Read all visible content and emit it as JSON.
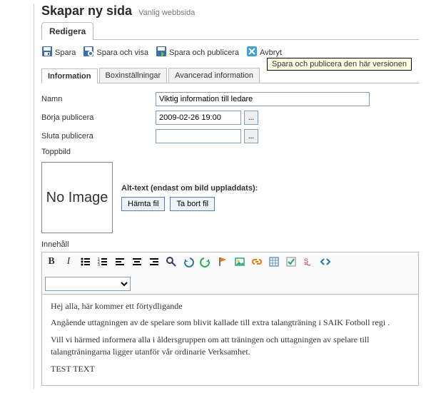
{
  "page": {
    "title": "Skapar ny sida",
    "subtitle": "Vanlig webbsida"
  },
  "mainTab": {
    "label": "Redigera"
  },
  "toolbar": {
    "save": "Spara",
    "saveShow": "Spara och visa",
    "savePublish": "Spara och publicera",
    "cancel": "Avbryt"
  },
  "tooltip": "Spara och publicera den här versionen",
  "subtabs": {
    "info": "Information",
    "box": "Boxinställningar",
    "adv": "Avancerad information"
  },
  "form": {
    "name_label": "Namn",
    "name_value": "Viktig information till ledare",
    "start_label": "Börja publicera",
    "start_value": "2009-02-26 19:00",
    "end_label": "Sluta publicera",
    "end_value": "",
    "topimg_label": "Toppbild",
    "noimage_text": "No Image",
    "alt_label": "Alt-text (endast om bild uppladdats):",
    "get_file": "Hämta fil",
    "remove_file": "Ta bort fil",
    "picker": "..."
  },
  "editor": {
    "label": "Innehåll",
    "p1": "Hej alla, här kommer ett förtydligande",
    "p2": "Angående uttagningen av de spelare som blivit kallade till extra talangträning i SAIK Fotboll regi .",
    "p3": "Vill vi härmed informera alla i åldersgruppen om att träningen och uttagningen av spelare till talangträningarna ligger utanför vår ordinarie Verksamhet.",
    "p4": "TEST TEXT"
  }
}
